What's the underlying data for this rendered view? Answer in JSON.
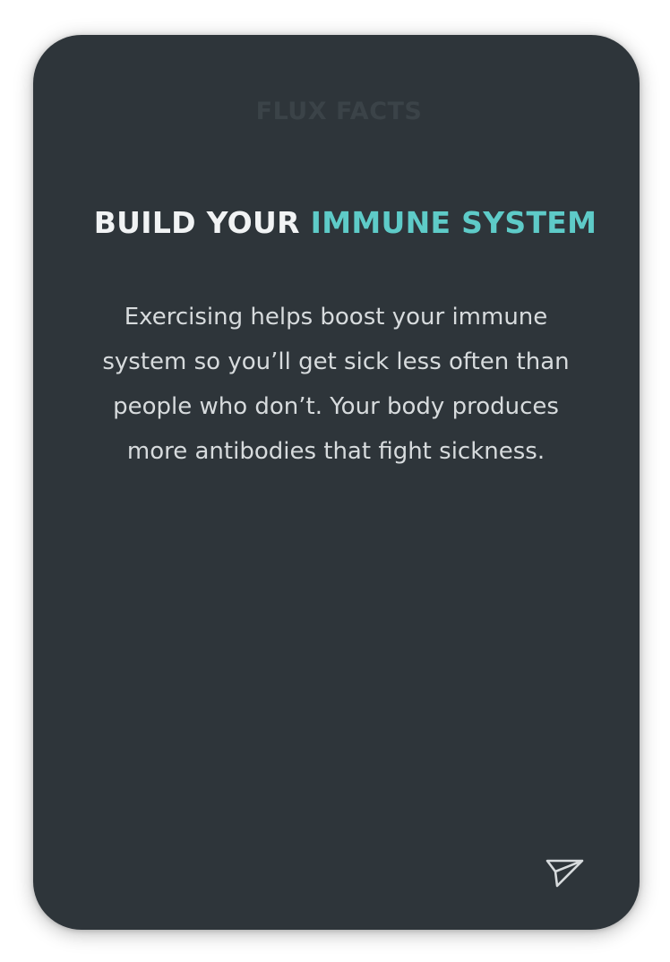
{
  "card": {
    "brand": "FLUX FACTS",
    "headline_plain": "BUILD YOUR",
    "headline_accent": "IMMUNE SYSTEM",
    "body": "Exercising helps boost your immune system so you’ll get sick less often than people who don’t. Your body produces more antibodies that fight sickness.",
    "share_icon": "send-icon"
  },
  "colors": {
    "card_background": "#2e353a",
    "accent": "#5ecbc8",
    "brand_text": "#3b4348",
    "headline_text": "#f1f3f4",
    "body_text": "#d7dbdd"
  }
}
